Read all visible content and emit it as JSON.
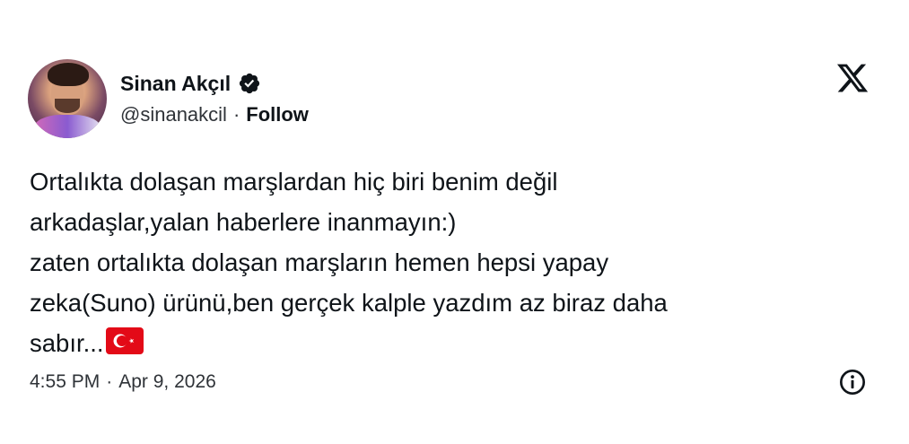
{
  "author": {
    "name": "Sinan Akçıl",
    "handle": "@sinanakcil",
    "separator": "·",
    "follow_label": "Follow",
    "verified_icon": "verified-badge-icon",
    "avatar_icon": "profile-photo"
  },
  "platform": {
    "logo_icon": "x-logo-icon"
  },
  "tweet": {
    "lines": [
      "Ortalıkta dolaşan marşlardan hiç biri benim değil",
      "arkadaşlar,yalan haberlere inanmayın:)",
      "zaten ortalıkta dolaşan marşların hemen hepsi yapay",
      "zeka(Suno) ürünü,ben gerçek kalple yazdım az biraz daha",
      "sabır..."
    ],
    "emoji_icon": "turkey-flag-icon"
  },
  "meta": {
    "time": "4:55 PM",
    "separator": "·",
    "date": "Apr 9, 2026",
    "info_icon": "info-icon"
  },
  "colors": {
    "text": "#0f1419",
    "secondary_text": "#2f3338",
    "flag_red": "#e30a17",
    "background": "#ffffff"
  }
}
